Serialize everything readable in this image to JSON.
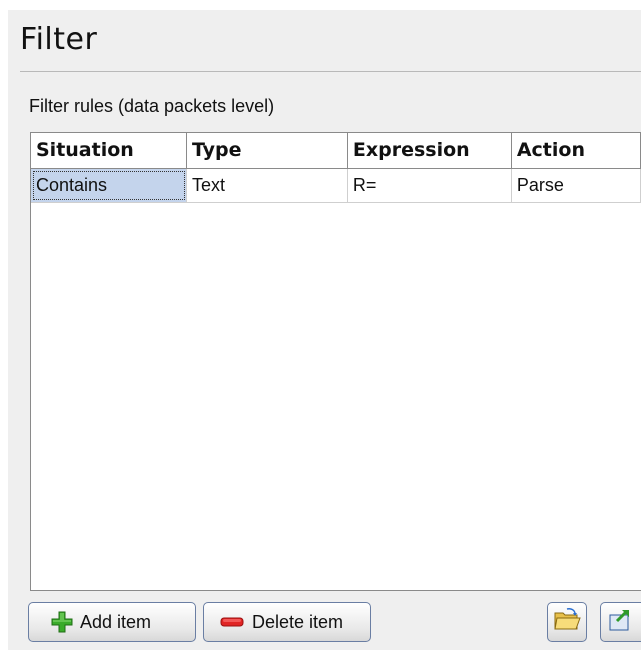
{
  "panel": {
    "title": "Filter",
    "subtitle": "Filter rules (data packets level)"
  },
  "grid": {
    "columns": [
      "Situation",
      "Type",
      "Expression",
      "Action"
    ],
    "rows": [
      [
        "Contains",
        "Text",
        "R=",
        "Parse"
      ]
    ],
    "selected_cell": "Contains"
  },
  "buttons": {
    "add_label": "Add item",
    "delete_label": "Delete item",
    "add_icon": "plus-icon",
    "delete_icon": "minus-icon",
    "open_icon": "open-folder-icon",
    "save_icon": "export-icon"
  },
  "colors": {
    "panel_bg": "#efefef",
    "selection": "#c4d4ec",
    "add_green": "#2e9a1f",
    "delete_red": "#d81c1c"
  }
}
